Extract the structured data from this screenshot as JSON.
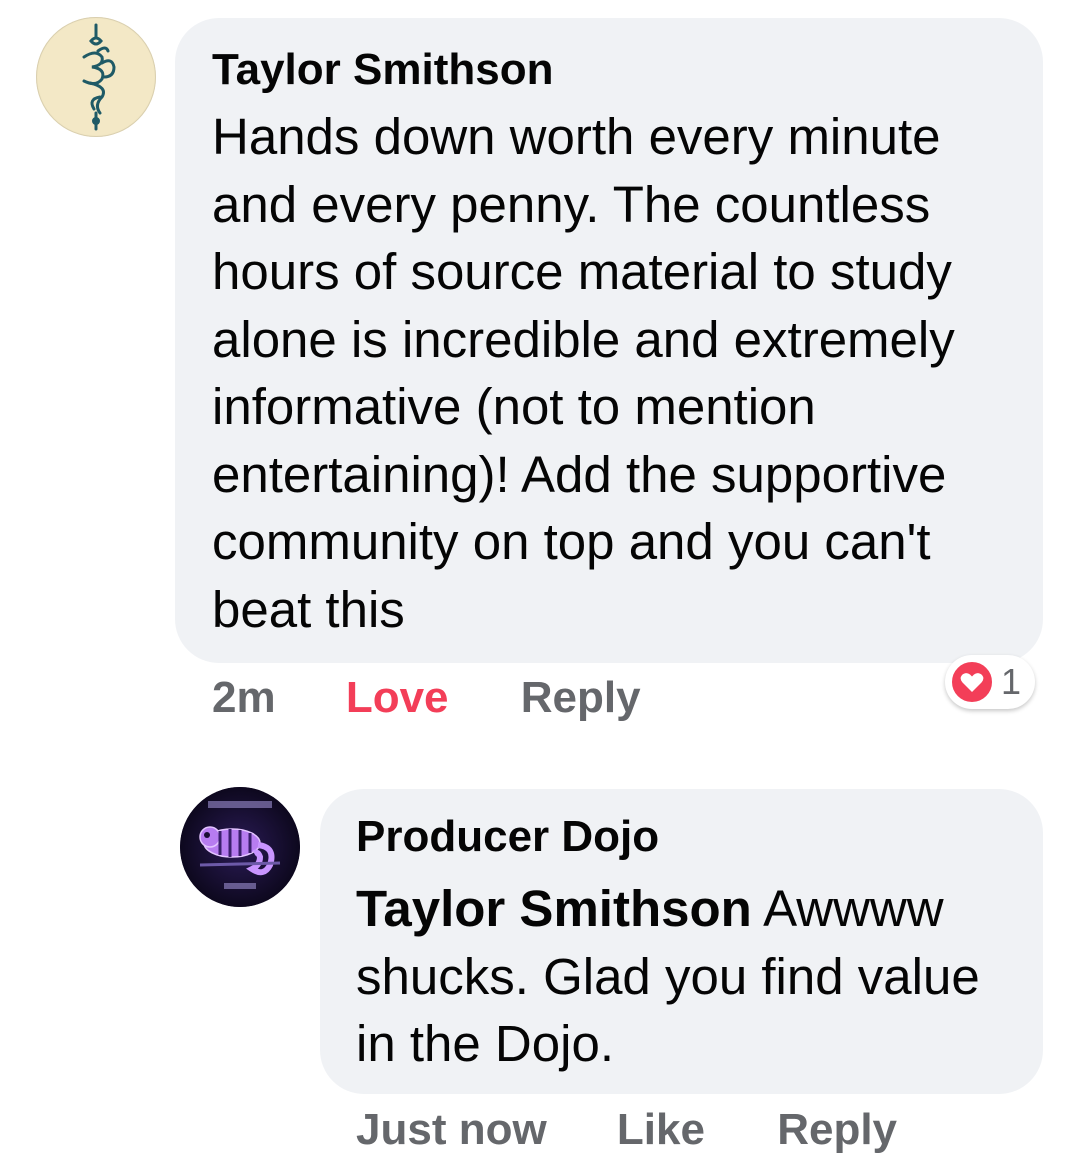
{
  "comment": {
    "author": "Taylor Smithson",
    "text": "Hands down worth every minute and every penny. The countless hours of source material to study alone is incredible and extremely informative (not to mention entertaining)! Add the supportive community on top and you can't beat this",
    "timestamp": "2m",
    "reaction_label": "Love",
    "reply_label": "Reply",
    "reaction_count": "1",
    "reaction_icon": "heart-icon",
    "love_color": "#f33e58"
  },
  "reply": {
    "author": "Producer Dojo",
    "mention": "Taylor Smithson",
    "text": " Awwww shucks. Glad you find value in the Dojo.",
    "timestamp": "Just now",
    "like_label": "Like",
    "reply_label": "Reply"
  },
  "colors": {
    "bubble_bg": "#f0f2f5",
    "meta_text": "#65676b",
    "love": "#f33e58"
  }
}
